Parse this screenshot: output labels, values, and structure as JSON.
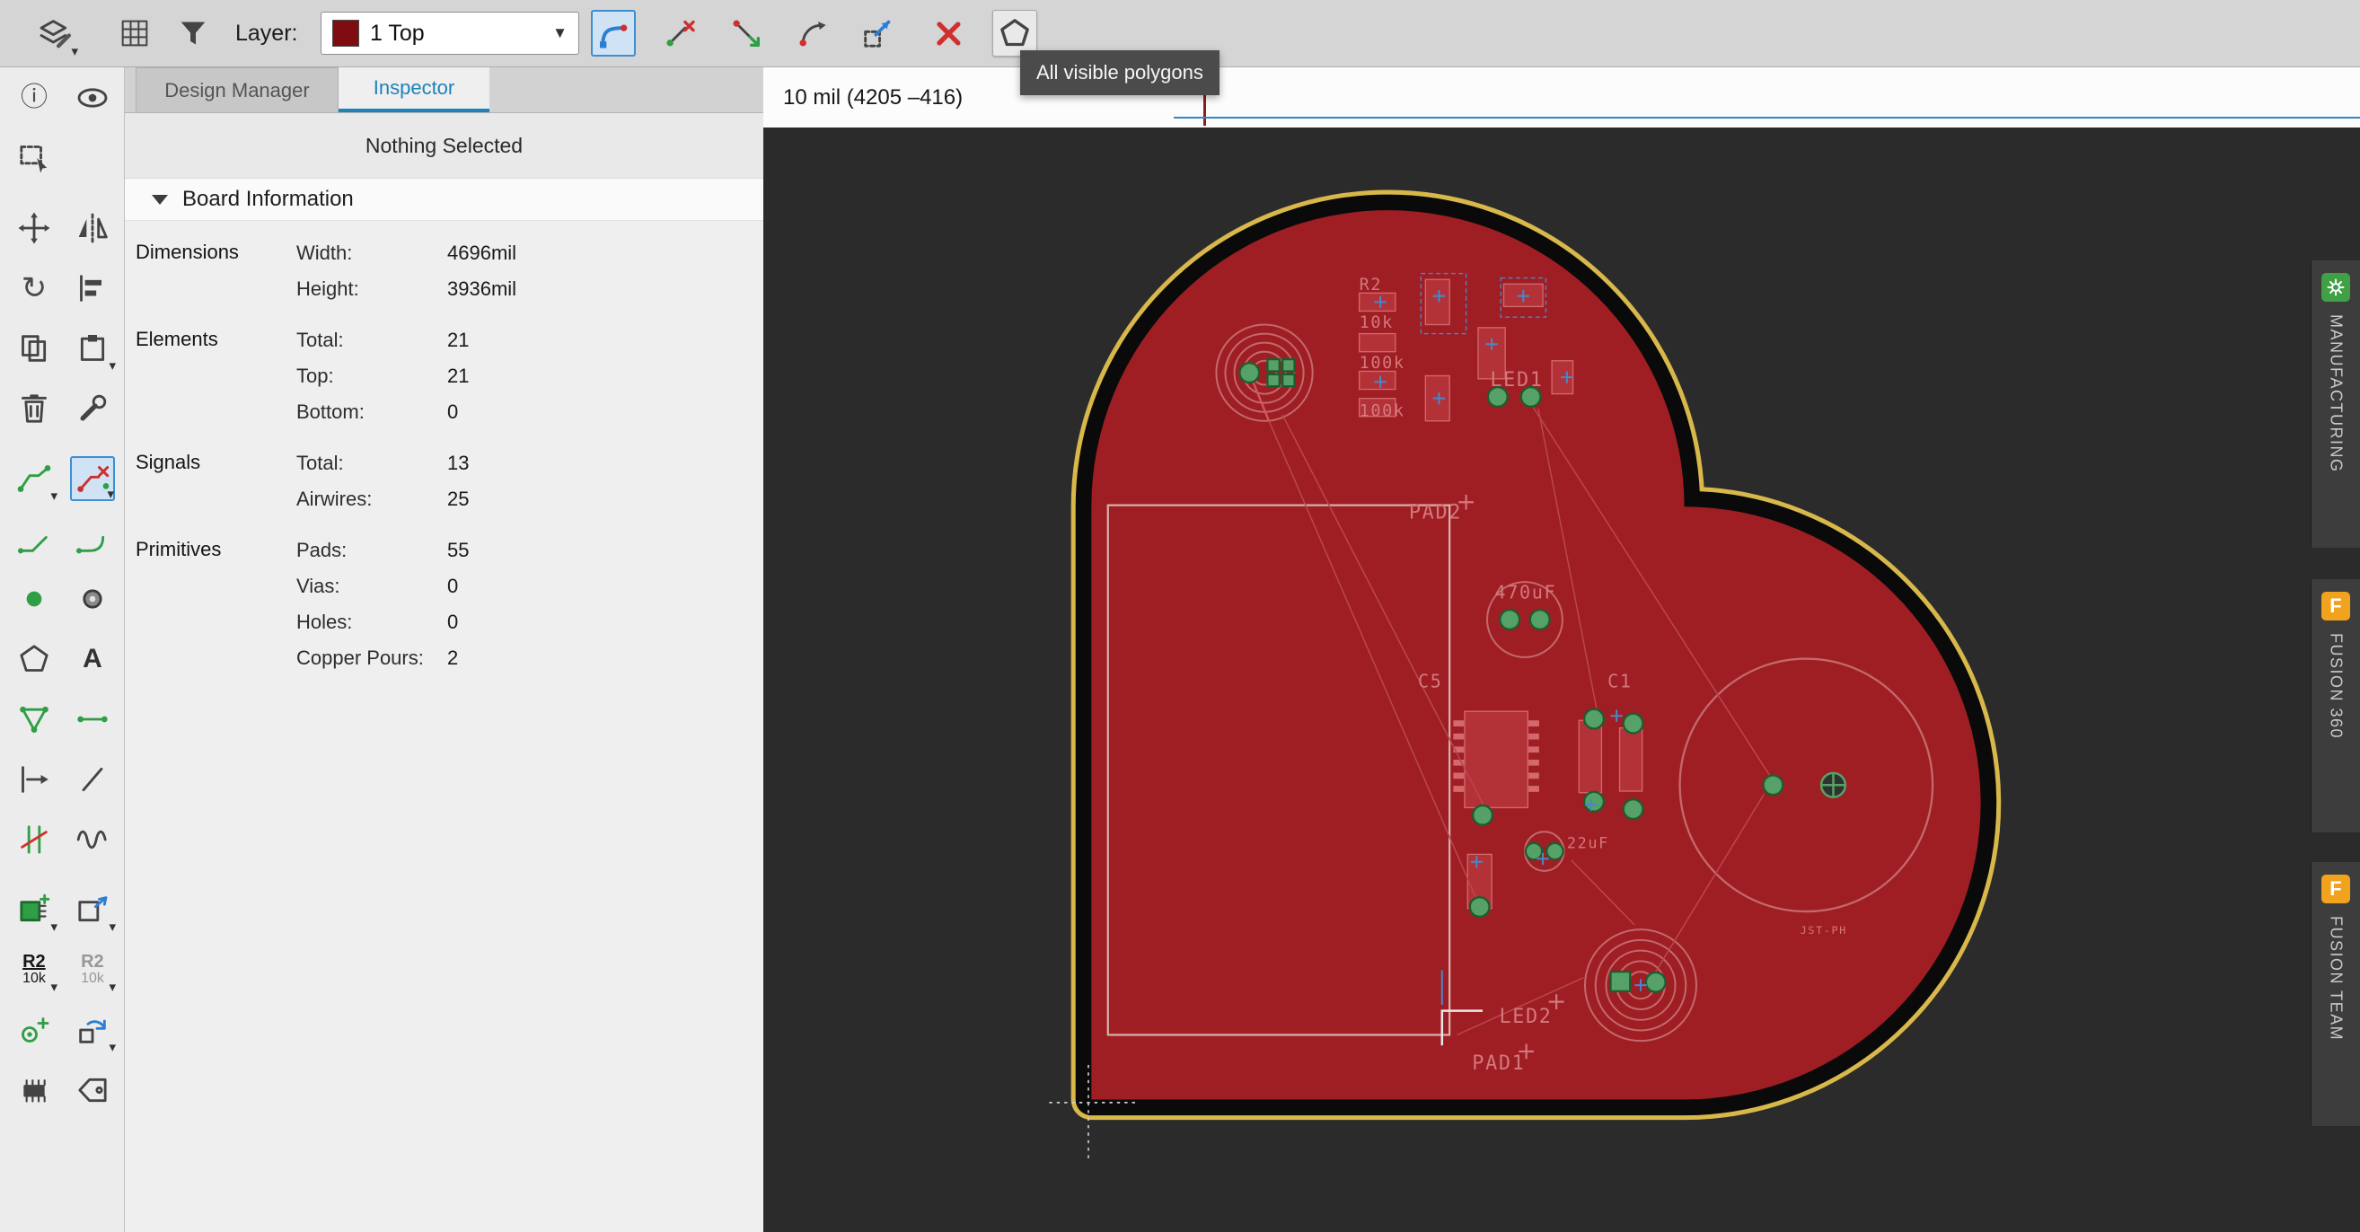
{
  "colors": {
    "accent-blue": "#1d82b8",
    "selection-blue": "#2f86c8",
    "toolbar-bg": "#d5d5d5",
    "panel-bg": "#efefef",
    "canvas-bg": "#2b2b2b",
    "layer-swatch": "#7e0c10",
    "board-red": "#9e1e24",
    "board-outline-yellow": "#d8b84a",
    "silk-red": "#c4686c",
    "label-red": "#d4787c",
    "pad-green": "#55a167",
    "pad-green-dark": "#1e5c30",
    "origin-blue": "#4a86c8",
    "tooltip-bg": "#4b4b4b",
    "fusion-orange": "#f2a31d",
    "manufacturing-green": "#3fa045"
  },
  "toolbar": {
    "layer_label": "Layer:",
    "layer_value": "1 Top",
    "tooltip": "All visible polygons"
  },
  "statusbar": {
    "coordinates": "10 mil (4205 –416)"
  },
  "inspector": {
    "tabs": [
      {
        "label": "Design Manager"
      },
      {
        "label": "Inspector"
      }
    ],
    "active_tab": "Inspector",
    "selection_status": "Nothing Selected",
    "board_information": {
      "title": "Board Information",
      "groups": [
        {
          "label": "Dimensions",
          "rows": [
            {
              "name": "Width:",
              "value": "4696mil"
            },
            {
              "name": "Height:",
              "value": "3936mil"
            }
          ]
        },
        {
          "label": "Elements",
          "rows": [
            {
              "name": "Total:",
              "value": "21"
            },
            {
              "name": "Top:",
              "value": "21"
            },
            {
              "name": "Bottom:",
              "value": "0"
            }
          ]
        },
        {
          "label": "Signals",
          "rows": [
            {
              "name": "Total:",
              "value": "13"
            },
            {
              "name": "Airwires:",
              "value": "25"
            }
          ]
        },
        {
          "label": "Primitives",
          "rows": [
            {
              "name": "Pads:",
              "value": "55"
            },
            {
              "name": "Vias:",
              "value": "0"
            },
            {
              "name": "Holes:",
              "value": "0"
            },
            {
              "name": "Copper Pours:",
              "value": "2"
            }
          ]
        }
      ]
    }
  },
  "tools": {
    "name_text": "R2",
    "value_text": "10k"
  },
  "board": {
    "labels": [
      "R2",
      "10k",
      "100k",
      "100k",
      "LED1",
      "PAD2",
      "470uF",
      "C5",
      "C1",
      "22uF",
      "LED2",
      "PAD1",
      "JST-PH"
    ]
  },
  "right_panel": {
    "tabs": [
      {
        "label": "MANUFACTURING"
      },
      {
        "label": "FUSION 360"
      },
      {
        "label": "FUSION TEAM"
      }
    ]
  }
}
